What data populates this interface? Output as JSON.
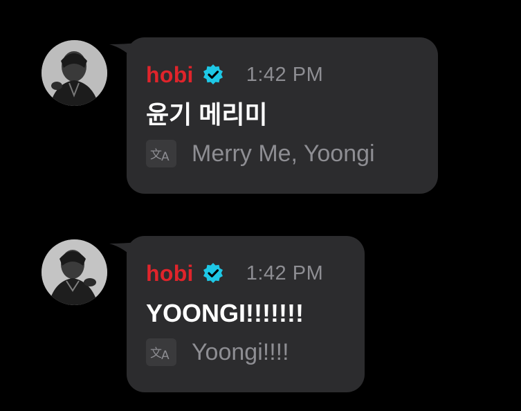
{
  "messages": [
    {
      "username": "hobi",
      "timestamp": "1:42 PM",
      "text": "윤기 메리미",
      "translation": "Merry Me, Yoongi"
    },
    {
      "username": "hobi",
      "timestamp": "1:42 PM",
      "text": "YOONGI!!!!!!!",
      "translation": "Yoongi!!!!"
    }
  ],
  "colors": {
    "background": "#000000",
    "bubble": "#2c2c2e",
    "username": "#e0242b",
    "verified_badge": "#1ec8e6",
    "timestamp": "#8e8e93",
    "message_text": "#ffffff",
    "translation_text": "#8e8e93"
  },
  "icons": {
    "verified": "verified-badge-icon",
    "translate": "translate-icon"
  }
}
